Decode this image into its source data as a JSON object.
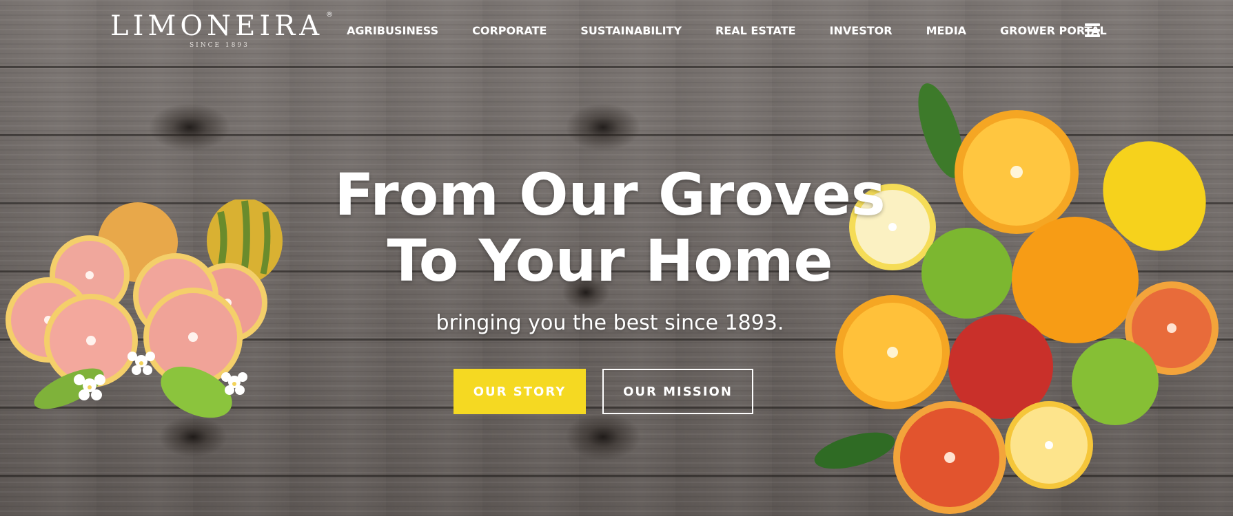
{
  "brand": {
    "name": "LIMONEIRA",
    "registered": "®",
    "since": "SINCE 1893"
  },
  "nav": {
    "items": [
      "AGRIBUSINESS",
      "CORPORATE",
      "SUSTAINABILITY",
      "REAL ESTATE",
      "INVESTOR",
      "MEDIA",
      "GROWER PORTAL"
    ],
    "menu_icon": "hamburger-menu-icon"
  },
  "hero": {
    "title_line1": "From Our Groves",
    "title_line2": "To Your Home",
    "subtitle": "bringing you the best since 1893.",
    "primary_button": "OUR STORY",
    "secondary_button": "OUR MISSION"
  },
  "colors": {
    "accent_yellow": "#f5d922",
    "text": "#ffffff",
    "wood": "#6d6764"
  }
}
